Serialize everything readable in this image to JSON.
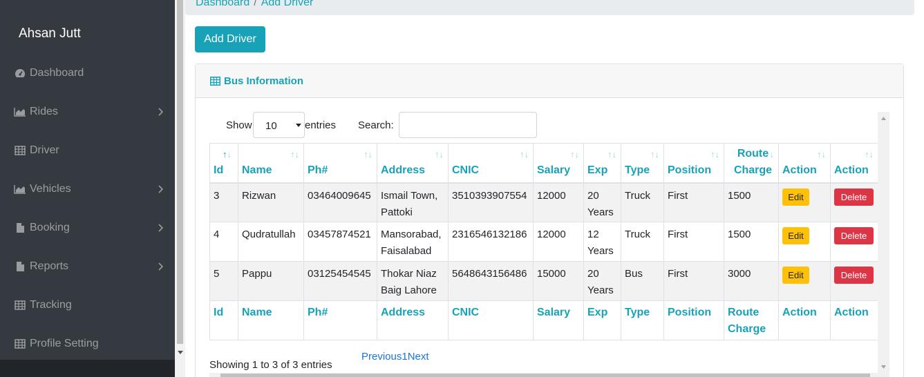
{
  "sidebar": {
    "brand": "Ahsan Jutt",
    "items": [
      {
        "label": "Dashboard",
        "icon": "dashboard-icon",
        "has_submenu": false
      },
      {
        "label": "Rides",
        "icon": "area-chart-icon",
        "has_submenu": true
      },
      {
        "label": "Driver",
        "icon": "table-icon",
        "has_submenu": false
      },
      {
        "label": "Vehicles",
        "icon": "area-chart-icon",
        "has_submenu": true
      },
      {
        "label": "Booking",
        "icon": "file-icon",
        "has_submenu": true
      },
      {
        "label": "Reports",
        "icon": "file-icon",
        "has_submenu": true
      },
      {
        "label": "Tracking",
        "icon": "table-icon",
        "has_submenu": false
      },
      {
        "label": "Profile Setting",
        "icon": "table-icon",
        "has_submenu": false
      }
    ]
  },
  "breadcrumb": {
    "home": "Dashboard",
    "separator": "/",
    "current": "Add Driver"
  },
  "add_button": "Add Driver",
  "card": {
    "title": "Bus Information"
  },
  "controls": {
    "show_label": "Show",
    "entries_value": "10",
    "entries_label": "entries",
    "search_label": "Search:",
    "search_value": ""
  },
  "table": {
    "columns": [
      "Id",
      "Name",
      "Ph#",
      "Address",
      "CNIC",
      "Salary",
      "Exp",
      "Type",
      "Position",
      "Route Charge",
      "Action",
      "Action"
    ],
    "rows": [
      {
        "id": "3",
        "name": "Rizwan",
        "phone": "03464009645",
        "address": "Ismail Town, Pattoki",
        "cnic": "3510393907554",
        "salary": "12000",
        "exp": "20 Years",
        "type": "Truck",
        "position": "First",
        "route_charge": "1500",
        "edit": "Edit",
        "delete": "Delete"
      },
      {
        "id": "4",
        "name": "Qudratullah",
        "phone": "03457874521",
        "address": "Mansorabad, Faisalabad",
        "cnic": "2316546132186",
        "salary": "12000",
        "exp": "12 Years",
        "type": "Truck",
        "position": "First",
        "route_charge": "1500",
        "edit": "Edit",
        "delete": "Delete"
      },
      {
        "id": "5",
        "name": "Pappu",
        "phone": "03125454545",
        "address": "Thokar Niaz Baig Lahore",
        "cnic": "5648643156486",
        "salary": "15000",
        "exp": "20 Years",
        "type": "Bus",
        "position": "First",
        "route_charge": "3000",
        "edit": "Edit",
        "delete": "Delete"
      }
    ]
  },
  "footer": {
    "info": "Showing 1 to 3 of 3 entries",
    "previous": "Previous",
    "page": "1",
    "next": "Next"
  },
  "colors": {
    "accent": "#17a2b8",
    "sidebar_bg": "#343a40",
    "edit": "#ffc107",
    "delete": "#dc3545"
  }
}
